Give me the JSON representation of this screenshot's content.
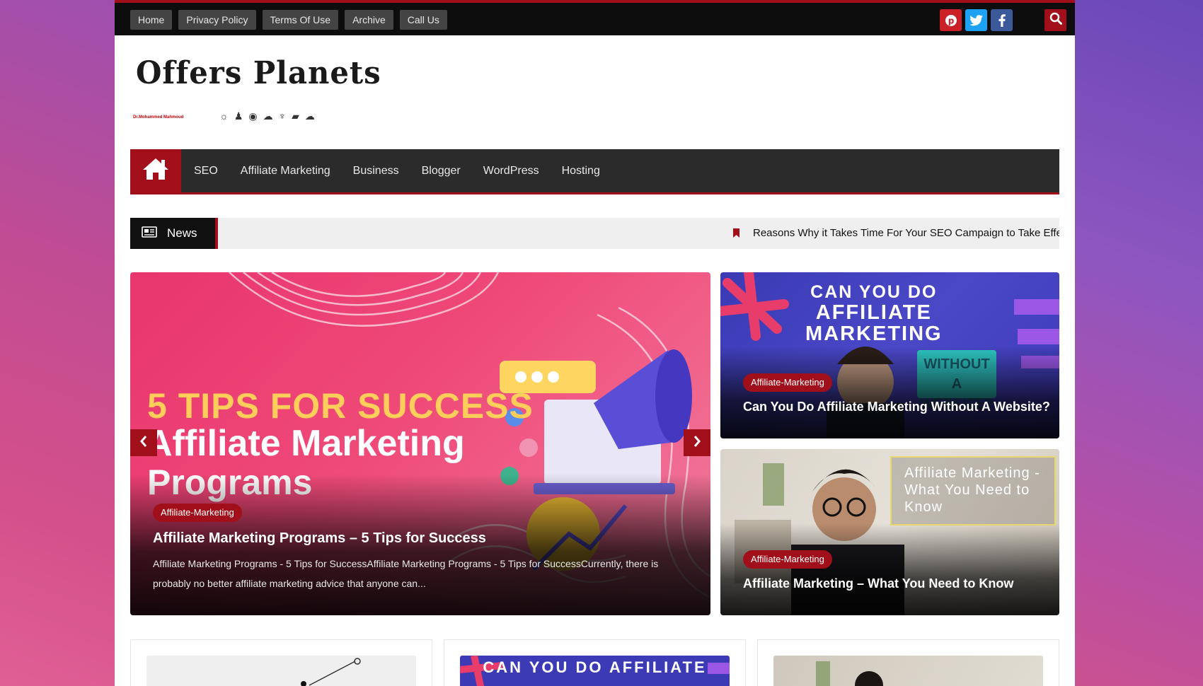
{
  "topbar": {
    "links": [
      "Home",
      "Privacy Policy",
      "Terms Of Use",
      "Archive",
      "Call Us"
    ],
    "social": [
      {
        "name": "pinterest-icon",
        "glyph": "P",
        "color": "#cb2027"
      },
      {
        "name": "twitter-icon",
        "glyph": "t",
        "color": "#1da1f2"
      },
      {
        "name": "facebook-icon",
        "glyph": "f",
        "color": "#3b5998"
      }
    ],
    "accent": "#a1101a"
  },
  "site": {
    "title": "Offers Planets",
    "tagline": "Dr.Mohammed Mahmoud"
  },
  "nav": {
    "items": [
      "SEO",
      "Affiliate Marketing",
      "Business",
      "Blogger",
      "WordPress",
      "Hosting"
    ]
  },
  "ticker": {
    "label": "News",
    "headline": "Reasons Why it Takes Time For Your SEO Campaign to Take Effect"
  },
  "featured": {
    "image_text": {
      "line1": "5 TIPS FOR SUCCESS",
      "line2": "Affiliate Marketing",
      "line3": "Programs"
    },
    "category": "Affiliate-Marketing",
    "title": "Affiliate Marketing Programs – 5 Tips for Success",
    "excerpt": "Affiliate Marketing Programs - 5 Tips for SuccessAffiliate Marketing Programs - 5 Tips for SuccessCurrently, there is probably no better affiliate marketing advice that anyone can..."
  },
  "side_posts": [
    {
      "image_text": "CAN YOU DO\nAFFILIATE\nMARKETING",
      "image_badge": "WITHOUT A\nWEBSITE?",
      "category": "Affiliate-Marketing",
      "title": "Can You Do Affiliate Marketing Without A Website?"
    },
    {
      "image_text": "Affiliate Marketing - What You Need to Know",
      "category": "Affiliate-Marketing",
      "title": "Affiliate Marketing – What You Need to Know"
    }
  ],
  "bottom_cards": [
    {
      "image_text": ""
    },
    {
      "image_text": "CAN YOU DO AFFILIATE"
    },
    {
      "image_text": ""
    }
  ]
}
